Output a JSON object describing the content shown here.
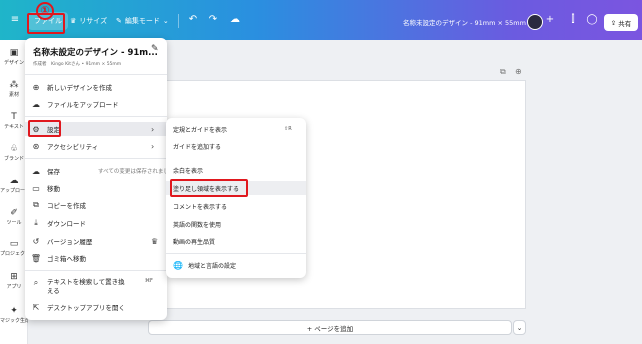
{
  "topbar": {
    "file_label": "ファイル",
    "resize_label": "リサイズ",
    "edit_mode_label": "編集モード",
    "doc_title": "名称未設定のデザイン - 91mm × 55mm",
    "share_label": "共有",
    "annotation_number": "①"
  },
  "leftbar": {
    "items": [
      {
        "label": "デザイン",
        "icon": "design-icon"
      },
      {
        "label": "素材",
        "icon": "elements-icon"
      },
      {
        "label": "テキスト",
        "icon": "text-icon"
      },
      {
        "label": "ブランド",
        "icon": "brand-icon"
      },
      {
        "label": "アップロード",
        "icon": "upload-icon"
      },
      {
        "label": "ツール",
        "icon": "draw-icon"
      },
      {
        "label": "プロジェクト",
        "icon": "folder-icon"
      },
      {
        "label": "アプリ",
        "icon": "apps-icon"
      },
      {
        "label": "マジック生成",
        "icon": "magic-icon"
      }
    ]
  },
  "file_menu": {
    "title": "名称未設定のデザイン - 91m...",
    "subtitle": "作成者　Kingo Kitさん • 91mm × 55mm",
    "new_design": "新しいデザインを作成",
    "upload_files": "ファイルをアップロード",
    "settings": "設定",
    "accessibility": "アクセシビリティ",
    "save": "保存",
    "save_hint": "すべての変更は保存されました",
    "move": "移動",
    "make_copy": "コピーを作成",
    "download": "ダウンロード",
    "version_history": "バージョン履歴",
    "trash": "ゴミ箱へ移動",
    "find_replace": "テキストを検索して置き換える",
    "find_replace_kbd": "⌘F",
    "desktop_app": "デスクトップアプリを開く"
  },
  "settings_submenu": {
    "rulers_guides": "定規とガイドを表示",
    "rulers_kbd": "⇧R",
    "add_guides": "ガイドを追加する",
    "show_margins": "余白を表示",
    "show_bleed": "塗り足し領域を表示する",
    "show_comments": "コメントを表示する",
    "english_functions": "英語の関数を使用",
    "video_quality": "動画の再生品質",
    "region_language": "地域と言語の設定"
  },
  "canvas": {
    "add_page_label": "+ ページを追加"
  },
  "colors": {
    "highlight_red": "#e0181e",
    "topbar_start": "#1fb5c9",
    "topbar_end": "#7b55e0"
  }
}
